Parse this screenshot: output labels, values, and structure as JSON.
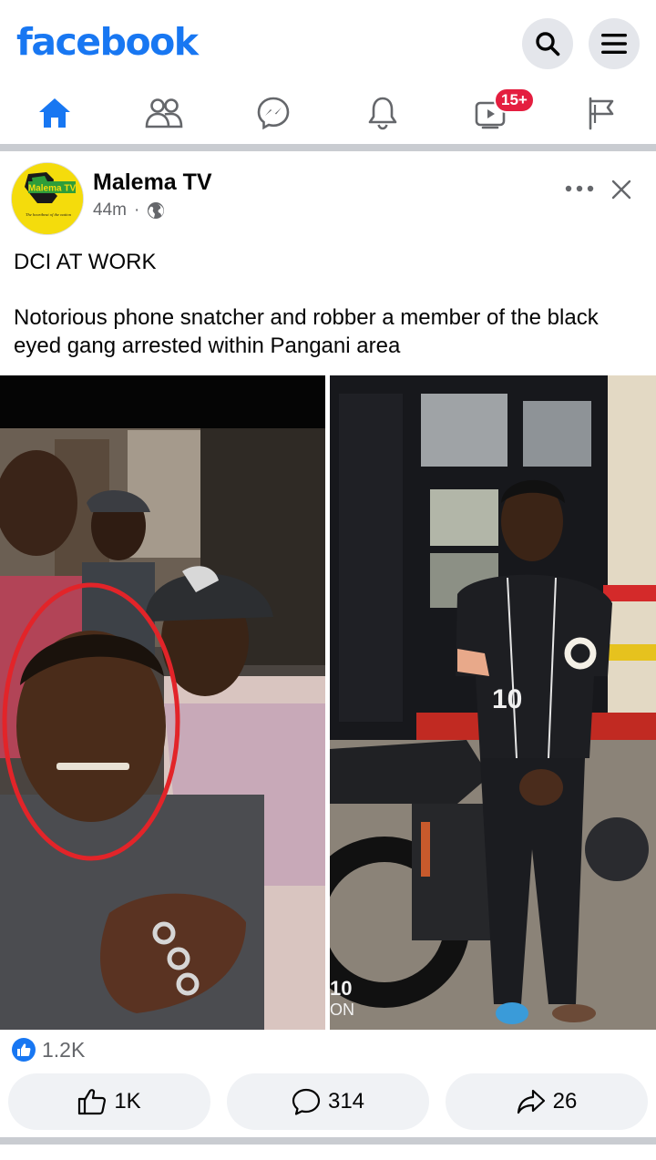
{
  "app": {
    "logo_text": "facebook",
    "brand_color": "#1877f2"
  },
  "header": {
    "search_icon": "search-icon",
    "menu_icon": "hamburger-menu-icon"
  },
  "nav": {
    "items": [
      {
        "name": "home",
        "icon": "home-icon",
        "active": true
      },
      {
        "name": "friends",
        "icon": "friends-icon"
      },
      {
        "name": "messenger",
        "icon": "messenger-icon"
      },
      {
        "name": "notifications",
        "icon": "bell-icon"
      },
      {
        "name": "watch",
        "icon": "video-icon",
        "badge": "15+"
      },
      {
        "name": "pages",
        "icon": "flag-icon"
      }
    ]
  },
  "post": {
    "page_name": "Malema TV",
    "avatar_text": "Malema TV",
    "avatar_tagline": "The heartbeat of the nation",
    "time": "44m",
    "separator": "·",
    "audience_icon": "globe-icon",
    "text_line1": "DCI AT WORK",
    "text_line2": "Notorious phone snatcher and robber a member of the black eyed gang arrested within Pangani area",
    "photo_left_alt": "group photo",
    "photo_right_alt": "arrested man",
    "right_photo_jersey_number": "10",
    "right_photo_text": "10\nON",
    "reactions_count": "1.2K",
    "like_count": "1K",
    "comment_count": "314",
    "share_count": "26"
  },
  "colors": {
    "text_primary": "#050505",
    "text_secondary": "#65676b",
    "button_bg": "#f0f2f5",
    "divider": "#c9ccd1",
    "badge": "#e41e3f"
  }
}
